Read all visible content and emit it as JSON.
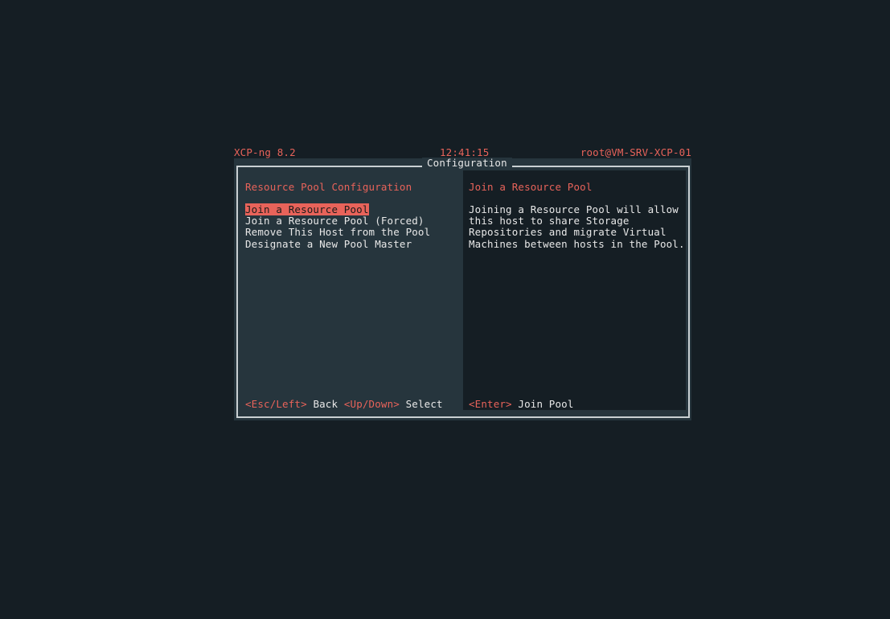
{
  "header": {
    "product": "XCP-ng 8.2",
    "clock": "12:41:15",
    "user_host": "root@VM-SRV-XCP-01"
  },
  "dialog": {
    "title": "Configuration"
  },
  "left_pane": {
    "title": "Resource Pool Configuration",
    "menu": [
      "Join a Resource Pool",
      "Join a Resource Pool (Forced)",
      "Remove This Host from the Pool",
      "Designate a New Pool Master"
    ],
    "selected_index": 0
  },
  "right_pane": {
    "title": "Join a Resource Pool",
    "description": [
      "Joining a Resource Pool will allow",
      "this host to share Storage",
      "Repositories and migrate Virtual",
      "Machines between hosts in the Pool."
    ]
  },
  "footer": {
    "left": [
      {
        "key": "<Esc/Left>",
        "action": "Back"
      },
      {
        "key": "<Up/Down>",
        "action": "Select"
      }
    ],
    "right": [
      {
        "key": "<Enter>",
        "action": "Join Pool"
      }
    ]
  },
  "colors": {
    "background": "#151e24",
    "panel": "#26353d",
    "accent": "#e8635a",
    "text": "#e8e8e8",
    "border": "#c9d0d3"
  }
}
